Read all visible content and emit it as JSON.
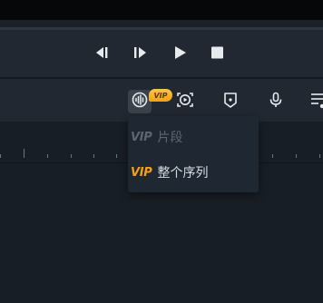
{
  "player": {
    "controls": [
      {
        "name": "prev-frame-icon"
      },
      {
        "name": "next-frame-icon"
      },
      {
        "name": "play-icon"
      },
      {
        "name": "stop-icon"
      }
    ]
  },
  "toolbar": {
    "buttons": [
      {
        "name": "audio-to-text-icon",
        "active": true
      },
      {
        "name": "video-target-icon"
      },
      {
        "name": "bookmark-shield-icon"
      },
      {
        "name": "microphone-icon"
      },
      {
        "name": "more-list-icon"
      }
    ],
    "vip_badge": "VIP"
  },
  "dropdown": {
    "items": [
      {
        "vip": "VIP",
        "label": "片段",
        "enabled": false
      },
      {
        "vip": "VIP",
        "label": "整个序列",
        "enabled": true
      }
    ]
  },
  "colors": {
    "accent": "#f3a118",
    "panel": "#212832",
    "background": "#1a2028"
  }
}
